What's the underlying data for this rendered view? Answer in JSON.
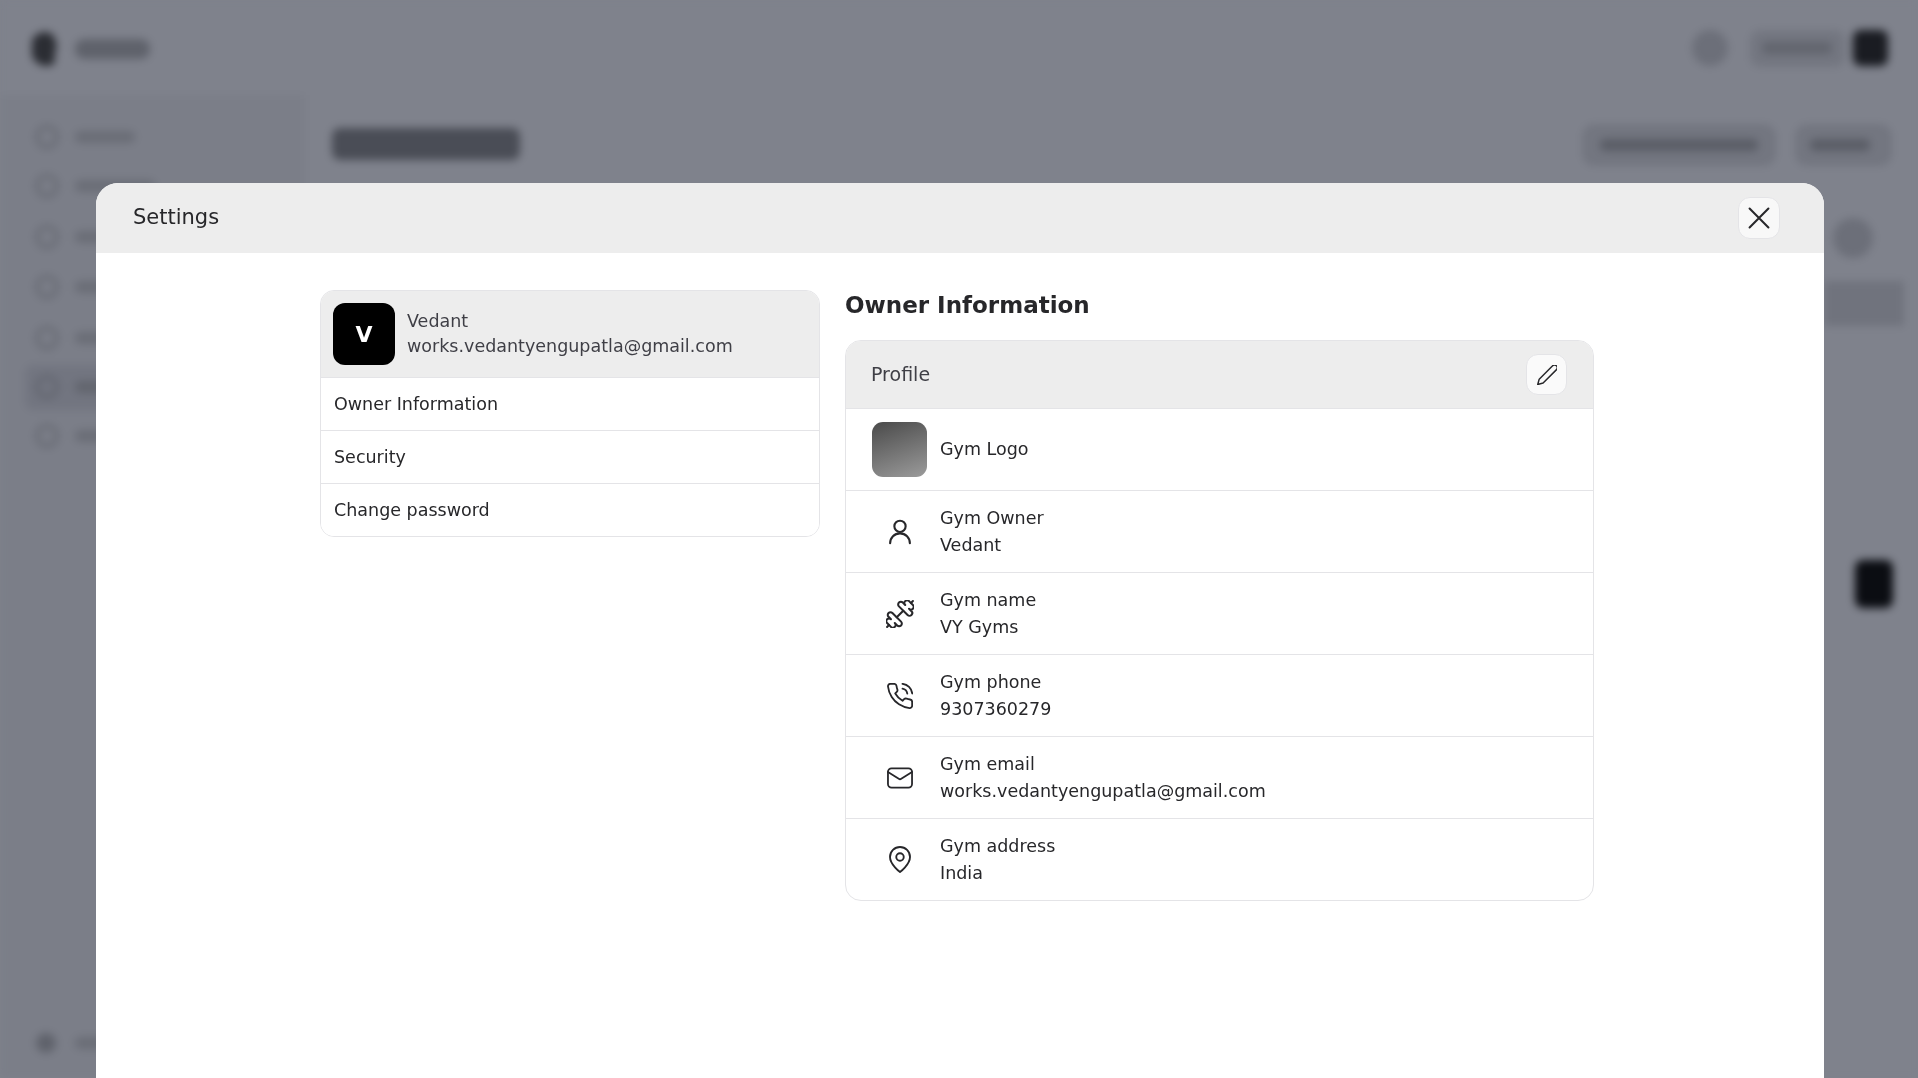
{
  "dialog": {
    "title": "Settings"
  },
  "account": {
    "initial": "V",
    "name": "Vedant",
    "email": "works.vedantyengupatla@gmail.com"
  },
  "menu": [
    {
      "label": "Owner Information",
      "selected": false
    },
    {
      "label": "Security",
      "selected": false
    },
    {
      "label": "Change password",
      "selected": false
    }
  ],
  "section": {
    "title": "Owner Information",
    "card_title": "Profile",
    "rows": [
      {
        "kind": "image",
        "label": "Gym Logo"
      },
      {
        "kind": "field",
        "label": "Gym Owner",
        "value": "Vedant"
      },
      {
        "kind": "field",
        "label": "Gym name",
        "value": "VY Gyms"
      },
      {
        "kind": "field",
        "label": "Gym phone",
        "value": "9307360279"
      },
      {
        "kind": "field",
        "label": "Gym email",
        "value": "works.vedantyengupatla@gmail.com"
      },
      {
        "kind": "field",
        "label": "Gym address",
        "value": "India"
      }
    ]
  }
}
